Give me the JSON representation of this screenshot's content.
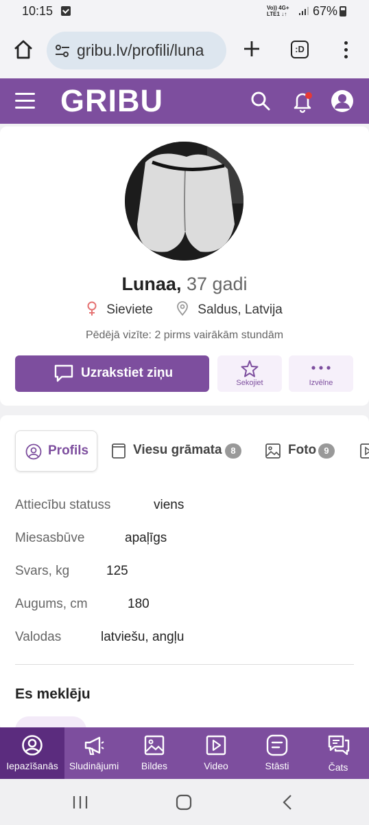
{
  "status_bar": {
    "time": "10:15",
    "network_line1": "Vo)) 4G+",
    "network_line2": "LTE1 ↓↑",
    "battery": "67%",
    "battery_level": 0.67
  },
  "browser": {
    "url": "gribu.lv/profili/luna",
    "tabs_label": ":D"
  },
  "header": {
    "logo": "GRIBU",
    "notification_dot_color": "#e53935"
  },
  "profile": {
    "name": "Lunaa,",
    "age": "37 gadi",
    "gender": "Sieviete",
    "location": "Saldus, Latvija",
    "last_visit": "Pēdējā vizīte: 2 pirms vairākām stundām",
    "message_button": "Uzrakstiet ziņu",
    "follow_button": "Sekojiet",
    "menu_button": "Izvēlne"
  },
  "tabs": [
    {
      "label": "Profils",
      "active": true
    },
    {
      "label": "Viesu grāmata",
      "count": "8"
    },
    {
      "label": "Foto",
      "count": "9"
    }
  ],
  "details": [
    {
      "key": "Attiecību statuss",
      "value": "viens"
    },
    {
      "key": "Miesasbūve",
      "value": "apaļīgs"
    },
    {
      "key": "Svars, kg",
      "value": "125"
    },
    {
      "key": "Augums, cm",
      "value": "180"
    },
    {
      "key": "Valodas",
      "value": "latviešu, angļu"
    }
  ],
  "seeking_title": "Es meklēju",
  "bottom_nav": [
    {
      "label": "Iepazīšanās",
      "icon": "user-circle-icon",
      "active": true
    },
    {
      "label": "Sludinājumi",
      "icon": "megaphone-icon"
    },
    {
      "label": "Bildes",
      "icon": "image-icon"
    },
    {
      "label": "Video",
      "icon": "play-icon"
    },
    {
      "label": "Stāsti",
      "icon": "stories-icon"
    },
    {
      "label": "Čats",
      "icon": "chat-icon"
    }
  ],
  "colors": {
    "brand": "#7d4e9e",
    "brand_dark": "#5b2c7e"
  }
}
